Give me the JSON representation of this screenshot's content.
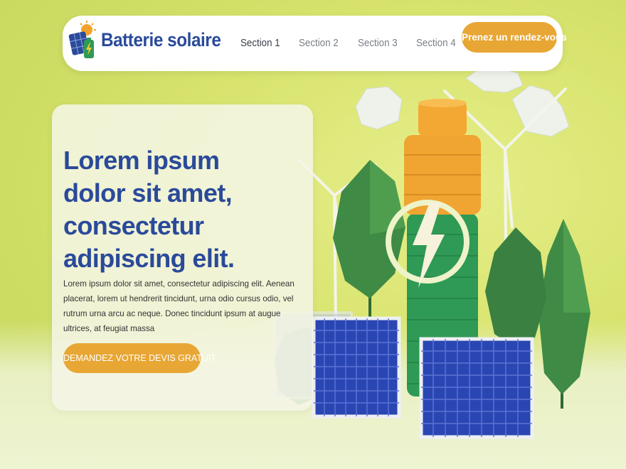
{
  "brand": {
    "name": "Batterie solaire",
    "logo_icon": "solar-battery-logo-icon"
  },
  "nav": {
    "items": [
      {
        "label": "Section 1",
        "active": true
      },
      {
        "label": "Section 2",
        "active": false
      },
      {
        "label": "Section 3",
        "active": false
      },
      {
        "label": "Section 4",
        "active": false
      }
    ],
    "cta_label": "Prenez un rendez-vous"
  },
  "hero": {
    "title": "Lorem ipsum dolor sit amet, consectetur adipiscing elit.",
    "body": "Lorem ipsum dolor sit amet, consectetur adipiscing elit. Aenean placerat, lorem ut hendrerit tincidunt, urna odio cursus odio, vel rutrum urna arcu ac neque. Donec tincidunt ipsum at augue ultrices, at feugiat massa",
    "cta_label": "DEMANDEZ VOTRE DEVIS GRATUIT"
  },
  "colors": {
    "brand_blue": "#2a4a9a",
    "accent_orange": "#e8a634",
    "background_green": "#d7e36c",
    "battery_green": "#2f9a55"
  }
}
